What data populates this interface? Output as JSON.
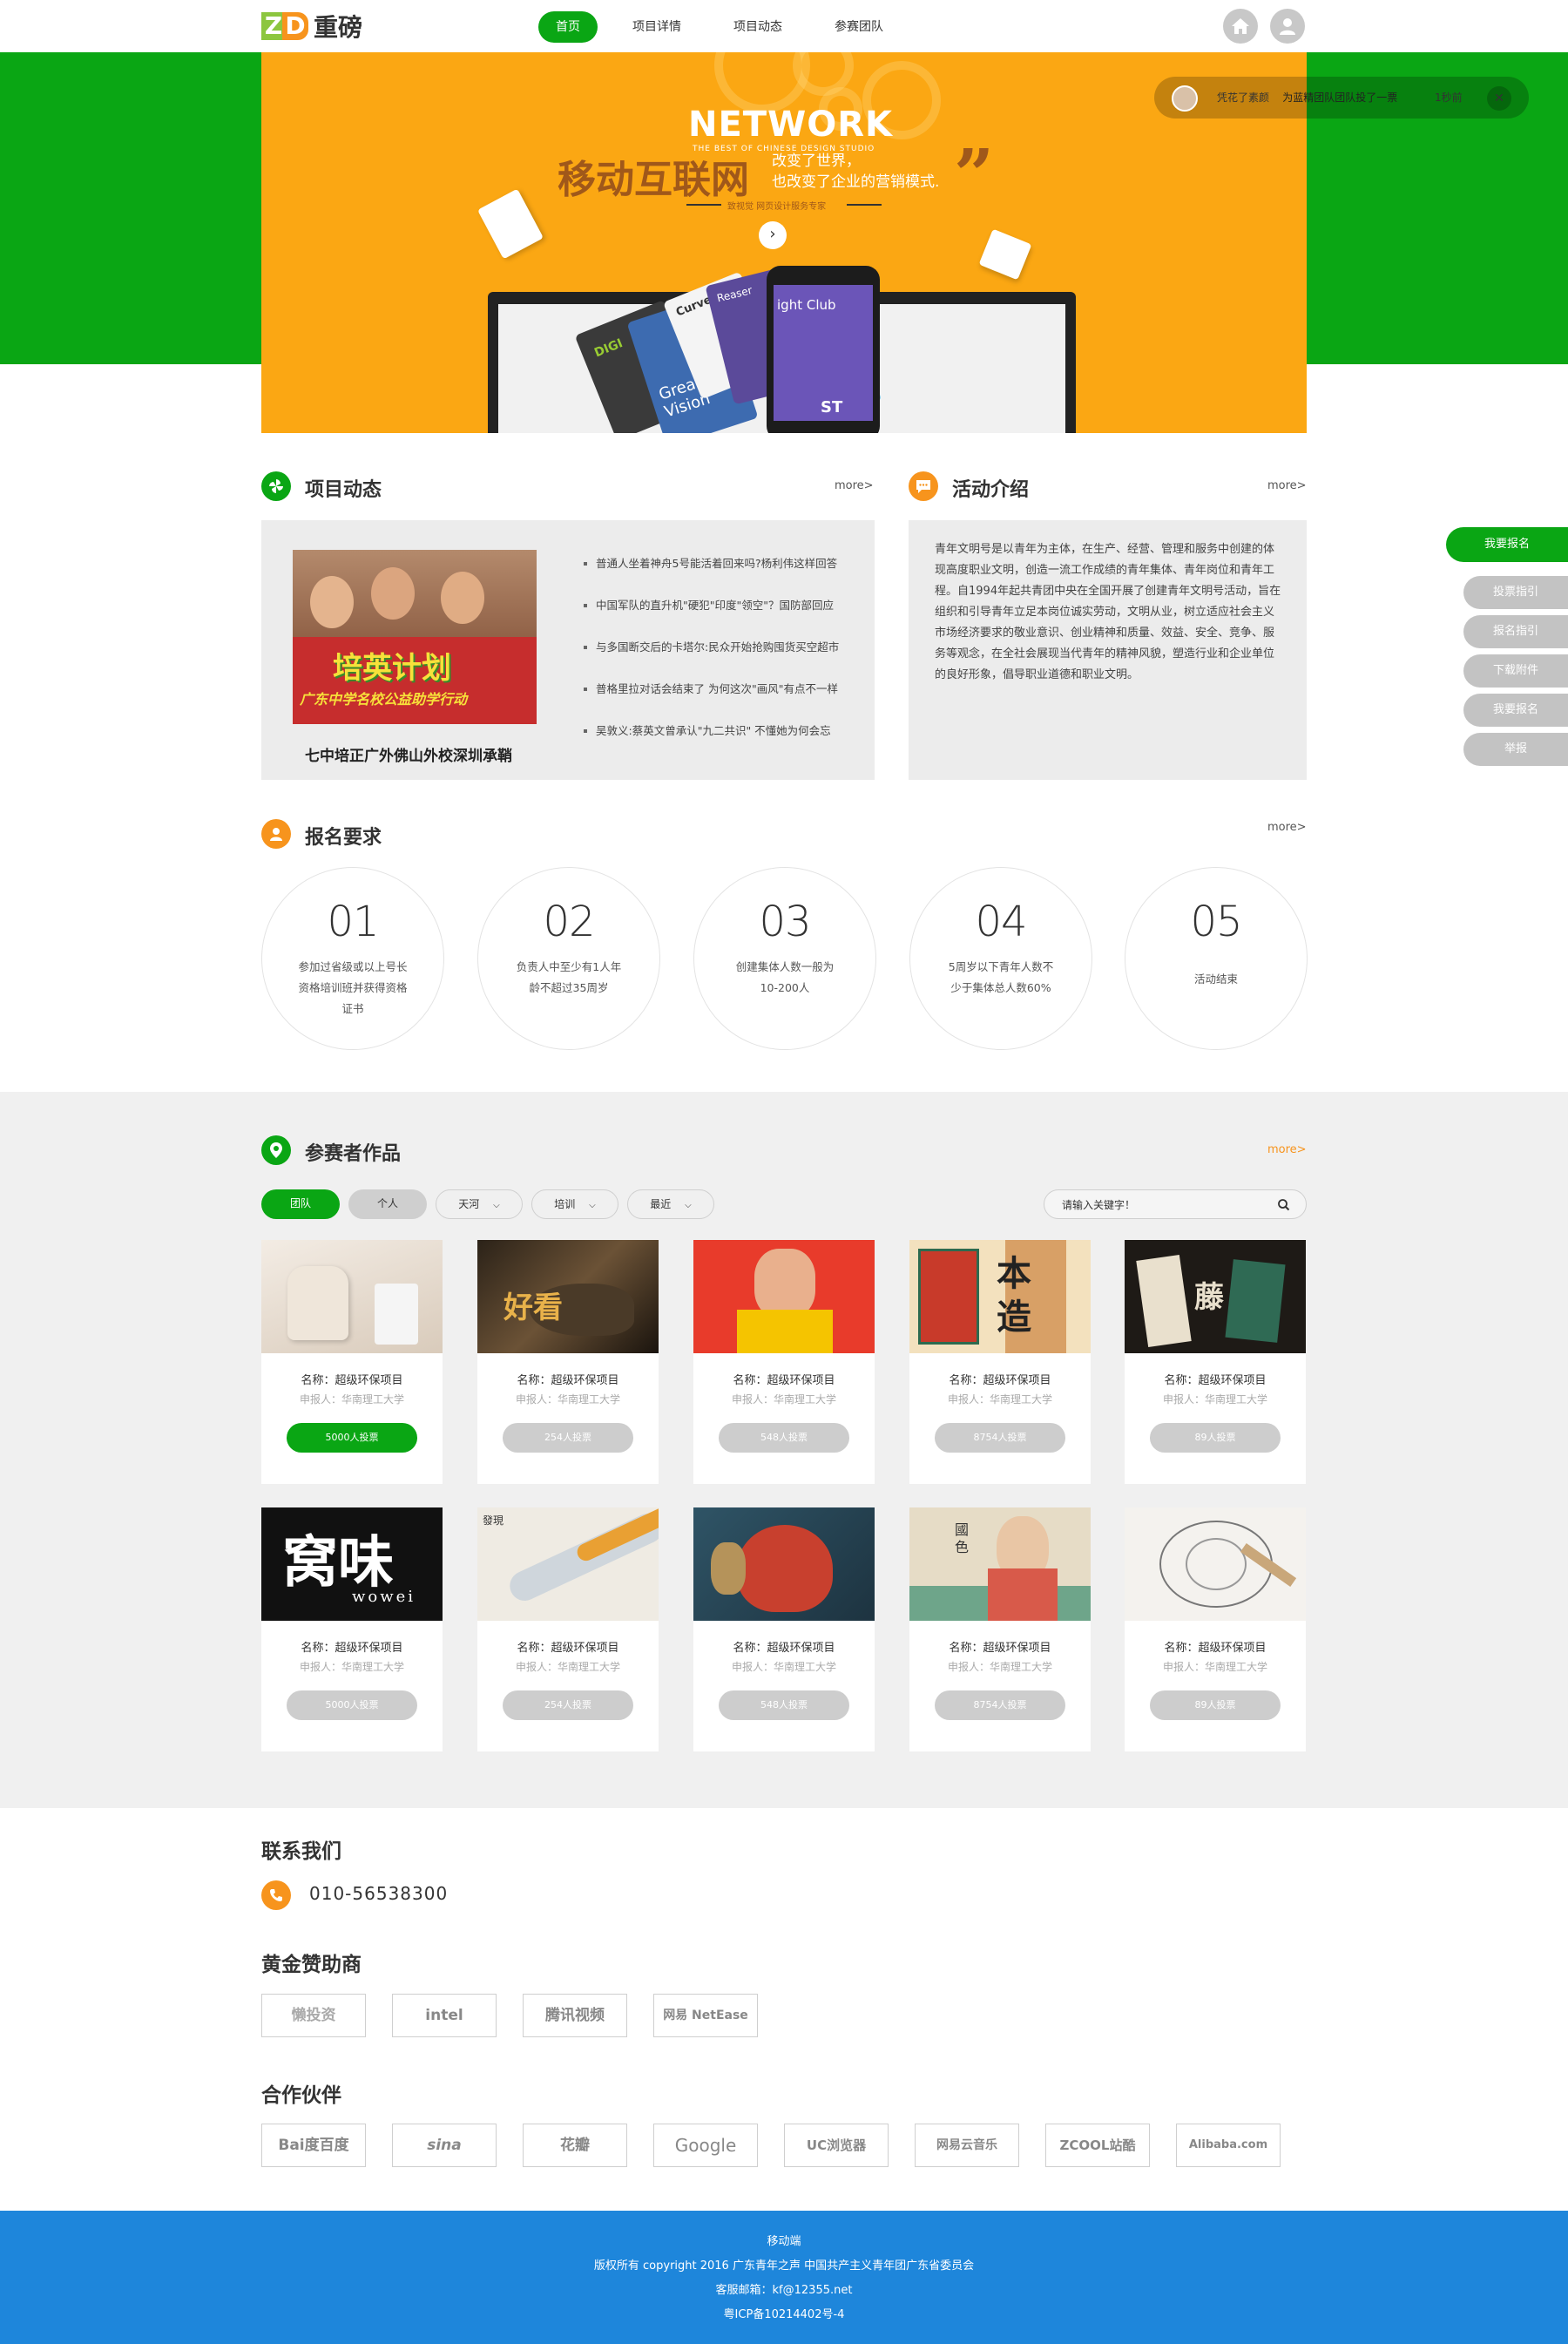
{
  "header": {
    "logo_mark_left": "Z",
    "logo_mark_right": "D",
    "logo_text": "重磅",
    "nav": [
      {
        "label": "首页",
        "active": true
      },
      {
        "label": "项目详情",
        "active": false
      },
      {
        "label": "项目动态",
        "active": false
      },
      {
        "label": "参赛团队",
        "active": false
      }
    ],
    "icons": [
      "home-icon",
      "user-icon"
    ]
  },
  "banner": {
    "title_en": "NETWORK",
    "subtitle_en": "THE BEST OF CHINESE DESIGN STUDIO",
    "title_cn": "移动互联网",
    "line1": "改变了世界，",
    "line2": "也改变了企业的营销模式.",
    "small_text": "致视觉 网页设计服务专家",
    "card_texts": [
      "Curve",
      "Great Vision",
      "DIGI",
      "ight Club",
      "Reaser",
      "ST"
    ],
    "colors": {
      "background": "#fba713",
      "side": "#0aa614"
    }
  },
  "toast": {
    "user": "凭花了素颜",
    "action": "为蓝精团队团队投了一票",
    "time": "1秒前",
    "close_icon": "close-icon"
  },
  "news_section": {
    "title": "项目动态",
    "more": "more>",
    "image_caption_big": "培英计划",
    "image_caption_small": "广东中学名校公益助学行动",
    "caption": "七中培正广外佛山外校深圳承鞘",
    "items": [
      "普通人坐着神舟5号能活着回来吗?杨利伟这样回答",
      "中国军队的直升机\"硬犯\"印度\"领空\"？国防部回应",
      "与多国断交后的卡塔尔:民众开始抢购囤货买空超市",
      "普格里拉对话会结束了 为何这次\"画风\"有点不一样",
      "吴敦义:蔡英文曾承认\"九二共识\" 不懂她为何会忘"
    ]
  },
  "activity_section": {
    "title": "活动介绍",
    "more": "more>",
    "text": "青年文明号是以青年为主体，在生产、经营、管理和服务中创建的体现高度职业文明，创造一流工作成绩的青年集体、青年岗位和青年工程。自1994年起共青团中央在全国开展了创建青年文明号活动，旨在组织和引导青年立足本岗位诚实劳动，文明从业，树立适应社会主义市场经济要求的敬业意识、创业精神和质量、效益、安全、竞争、服务等观念，在全社会展现当代青年的精神风貌，塑造行业和企业单位的良好形象，倡导职业道德和职业文明。"
  },
  "sidebar": {
    "main": "我要报名",
    "items": [
      "投票指引",
      "报名指引",
      "下载附件",
      "我要报名",
      "举报"
    ]
  },
  "requirements": {
    "title": "报名要求",
    "more": "more>",
    "items": [
      {
        "num": "01",
        "text": "参加过省级或以上号长资格培训班并获得资格证书"
      },
      {
        "num": "02",
        "text": "负责人中至少有1人年龄不超过35周岁"
      },
      {
        "num": "03",
        "text": "创建集体人数一般为10-200人"
      },
      {
        "num": "04",
        "text": "5周岁以下青年人数不少于集体总人数60%"
      },
      {
        "num": "05",
        "text": "活动结束"
      }
    ]
  },
  "works": {
    "title": "参赛者作品",
    "more": "more>",
    "filters": [
      {
        "label": "团队",
        "active": true
      },
      {
        "label": "个人",
        "active": false,
        "kind": "pill"
      },
      {
        "label": "天河",
        "dropdown": true
      },
      {
        "label": "培训",
        "dropdown": true
      },
      {
        "label": "最近",
        "dropdown": true
      }
    ],
    "search_placeholder": "请输入关键字！",
    "cards": [
      {
        "name": "名称：超级环保项目",
        "sub": "申报人：华南理工大学",
        "votes": "5000人投票",
        "highlight": true,
        "img_text": ""
      },
      {
        "name": "名称：超级环保项目",
        "sub": "申报人：华南理工大学",
        "votes": "254人投票",
        "highlight": false,
        "img_text": "好看"
      },
      {
        "name": "名称：超级环保项目",
        "sub": "申报人：华南理工大学",
        "votes": "548人投票",
        "highlight": false,
        "img_text": ""
      },
      {
        "name": "名称：超级环保项目",
        "sub": "申报人：华南理工大学",
        "votes": "8754人投票",
        "highlight": false,
        "img_text": "本 造"
      },
      {
        "name": "名称：超级环保项目",
        "sub": "申报人：华南理工大学",
        "votes": "89人投票",
        "highlight": false,
        "img_text": "藤"
      },
      {
        "name": "名称：超级环保项目",
        "sub": "申报人：华南理工大学",
        "votes": "5000人投票",
        "highlight": false,
        "img_text": "窝味",
        "img_sub": "wowei"
      },
      {
        "name": "名称：超级环保项目",
        "sub": "申报人：华南理工大学",
        "votes": "254人投票",
        "highlight": false,
        "img_text": "發現"
      },
      {
        "name": "名称：超级环保项目",
        "sub": "申报人：华南理工大学",
        "votes": "548人投票",
        "highlight": false,
        "img_text": ""
      },
      {
        "name": "名称：超级环保项目",
        "sub": "申报人：华南理工大学",
        "votes": "8754人投票",
        "highlight": false,
        "img_text": "國色"
      },
      {
        "name": "名称：超级环保项目",
        "sub": "申报人：华南理工大学",
        "votes": "89人投票",
        "highlight": false,
        "img_text": ""
      }
    ]
  },
  "contact": {
    "title": "联系我们",
    "phone": "010-56538300"
  },
  "sponsors": {
    "title": "黄金赞助商",
    "items": [
      "懒投资",
      "intel",
      "腾讯视频",
      "网易 NetEase"
    ]
  },
  "partners": {
    "title": "合作伙伴",
    "items": [
      "Bai度百度",
      "sina",
      "花瓣",
      "Google",
      "UC浏览器",
      "网易云音乐",
      "ZCOOL站酷",
      "Alibaba.com"
    ]
  },
  "footer": {
    "line1": "移动端",
    "line2": "版权所有 copyright  2016  广东青年之声   中国共产主义青年团广东省委员会",
    "line3": "客服邮箱：kf@12355.net",
    "line4": "粤ICP备10214402号-4",
    "color": "#1e86db"
  }
}
